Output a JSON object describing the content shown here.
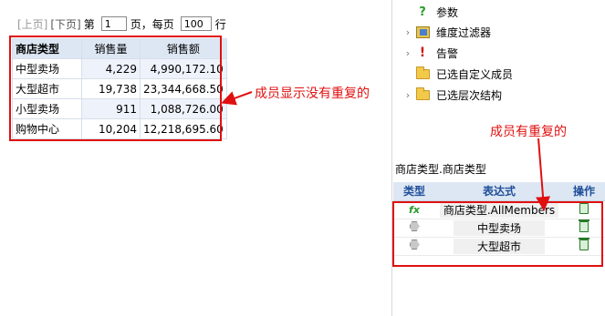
{
  "pager": {
    "prev": "[上页]",
    "next": "[下页]",
    "page_prefix": "第",
    "page_value": "1",
    "page_suffix": "页，每页",
    "per_page_value": "100",
    "rows_suffix": "行"
  },
  "grid": {
    "corner": "商店类型",
    "columns": [
      "销售量",
      "销售额"
    ],
    "rows": [
      {
        "label": "中型卖场",
        "values": [
          "4,229",
          "4,990,172.10"
        ]
      },
      {
        "label": "大型超市",
        "values": [
          "19,738",
          "23,344,668.50"
        ]
      },
      {
        "label": "小型卖场",
        "values": [
          "911",
          "1,088,726.00"
        ]
      },
      {
        "label": "购物中心",
        "values": [
          "10,204",
          "12,218,695.60"
        ]
      }
    ]
  },
  "annotations": {
    "left": "成员显示没有重复的",
    "right": "成员有重复的"
  },
  "tree": {
    "items": [
      {
        "label": "参数",
        "icon": "question-icon",
        "expandable": false
      },
      {
        "label": "维度过滤器",
        "icon": "filter-icon",
        "expandable": true
      },
      {
        "label": "告警",
        "icon": "alert-icon",
        "expandable": true
      },
      {
        "label": "已选自定义成员",
        "icon": "folder-icon",
        "expandable": false
      },
      {
        "label": "已选层次结构",
        "icon": "folder-icon",
        "expandable": true
      }
    ]
  },
  "members": {
    "title": "商店类型.商店类型",
    "headers": [
      "类型",
      "表达式",
      "操作"
    ],
    "rows": [
      {
        "type_icon": "fx-icon",
        "type_text": "fx",
        "expression": "商店类型.AllMembers",
        "action_icon": "trash-icon"
      },
      {
        "type_icon": "member-icon",
        "type_text": "",
        "expression": "中型卖场",
        "action_icon": "trash-icon"
      },
      {
        "type_icon": "member-icon",
        "type_text": "",
        "expression": "大型超市",
        "action_icon": "trash-icon"
      }
    ]
  },
  "colors": {
    "highlight": "#e01010",
    "header_bg": "#dde7f4",
    "header_text": "#1f4f99"
  }
}
